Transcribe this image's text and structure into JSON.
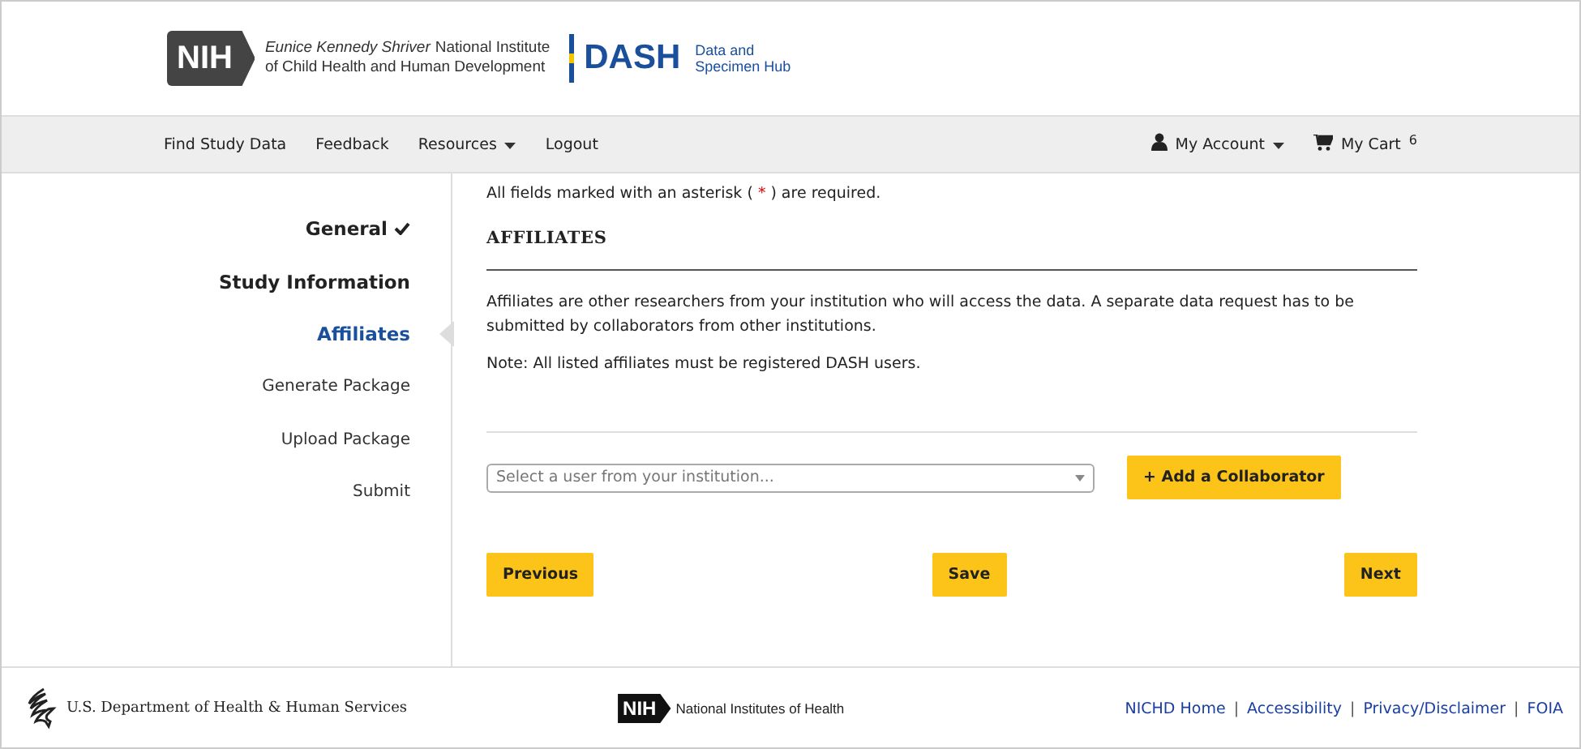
{
  "header": {
    "nih_badge": "NIH",
    "institute_italic": "Eunice Kennedy Shriver",
    "institute_rest": "National Institute",
    "institute_line2": "of Child Health and Human Development",
    "dash": "DASH",
    "dash_sub1": "Data and",
    "dash_sub2": "Specimen Hub"
  },
  "nav": {
    "left": [
      {
        "label": "Find Study Data",
        "dropdown": false
      },
      {
        "label": "Feedback",
        "dropdown": false
      },
      {
        "label": "Resources",
        "dropdown": true
      },
      {
        "label": "Logout",
        "dropdown": false
      }
    ],
    "account": {
      "label": "My Account",
      "dropdown": true
    },
    "cart": {
      "label": "My Cart",
      "count": "6"
    }
  },
  "steps": [
    {
      "label": "General",
      "kind": "done",
      "selected": false
    },
    {
      "label": "Study Information",
      "kind": "visited",
      "selected": false
    },
    {
      "label": "Affiliates",
      "kind": "visited",
      "selected": true
    },
    {
      "label": "Generate Package",
      "kind": "pending",
      "selected": false
    },
    {
      "label": "Upload Package",
      "kind": "pending",
      "selected": false
    },
    {
      "label": "Submit",
      "kind": "pending",
      "selected": false
    }
  ],
  "form": {
    "required_before": "All fields marked with an asterisk (",
    "asterisk": "*",
    "required_after": ") are required.",
    "heading": "AFFILIATES",
    "description": "Affiliates are other researchers from your institution who will access the data. A separate data request has to be submitted by collaborators from other institutions.",
    "note": "Note: All listed affiliates must be registered DASH users.",
    "select": {
      "placeholder": "Select a user from your institution..."
    },
    "add_button": "Add a Collaborator",
    "add_icon": "+",
    "buttons": [
      "Previous",
      "Save",
      "Next"
    ]
  },
  "footer": {
    "hhs": "U.S. Department of Health & Human Services",
    "nih_badge": "NIH",
    "nih": "National Institutes of Health",
    "links": [
      "NICHD Home",
      "Accessibility",
      "Privacy/Disclaimer",
      "FOIA"
    ],
    "separator": "|"
  }
}
